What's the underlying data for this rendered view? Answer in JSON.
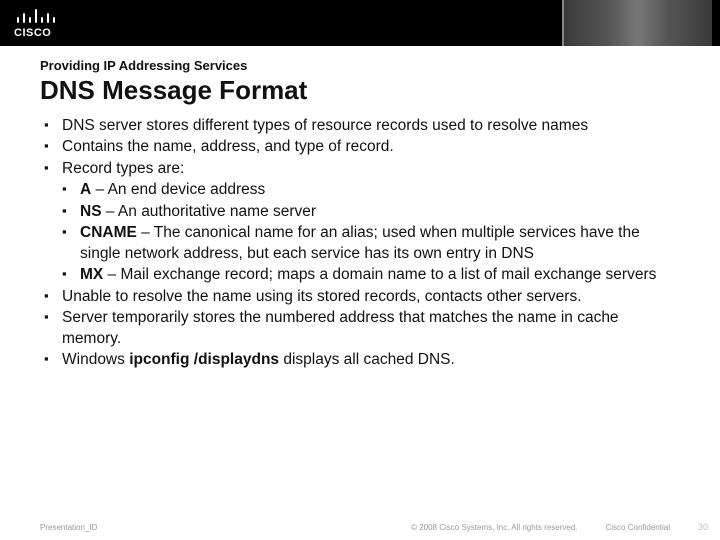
{
  "header": {
    "eyebrow": "Providing IP Addressing Services",
    "title": "DNS Message Format"
  },
  "bullets": [
    {
      "text": "DNS server stores different types of resource records used to resolve names"
    },
    {
      "text": "Contains the name, address, and type of record."
    },
    {
      "text": "Record types are:",
      "sub": [
        {
          "bold": "A",
          "rest": " – An end device address"
        },
        {
          "bold": "NS",
          "rest": " – An authoritative name server"
        },
        {
          "bold": "CNAME",
          "rest": " – The canonical name for an alias; used when multiple services have the single network address, but each service has its own entry in DNS"
        },
        {
          "bold": "MX",
          "rest": " – Mail exchange record; maps a domain name to a list of mail exchange servers"
        }
      ]
    },
    {
      "text": "Unable to resolve the name using its stored records, contacts other servers."
    },
    {
      "text": "Server temporarily stores the numbered address that matches the name in cache memory."
    },
    {
      "pre": "Windows ",
      "bold": "ipconfig /displaydns",
      "post": " displays all cached DNS."
    }
  ],
  "footer": {
    "left": "Presentation_ID",
    "copyright": "© 2008 Cisco Systems, Inc. All rights reserved.",
    "confidential": "Cisco Confidential",
    "page": "30"
  }
}
